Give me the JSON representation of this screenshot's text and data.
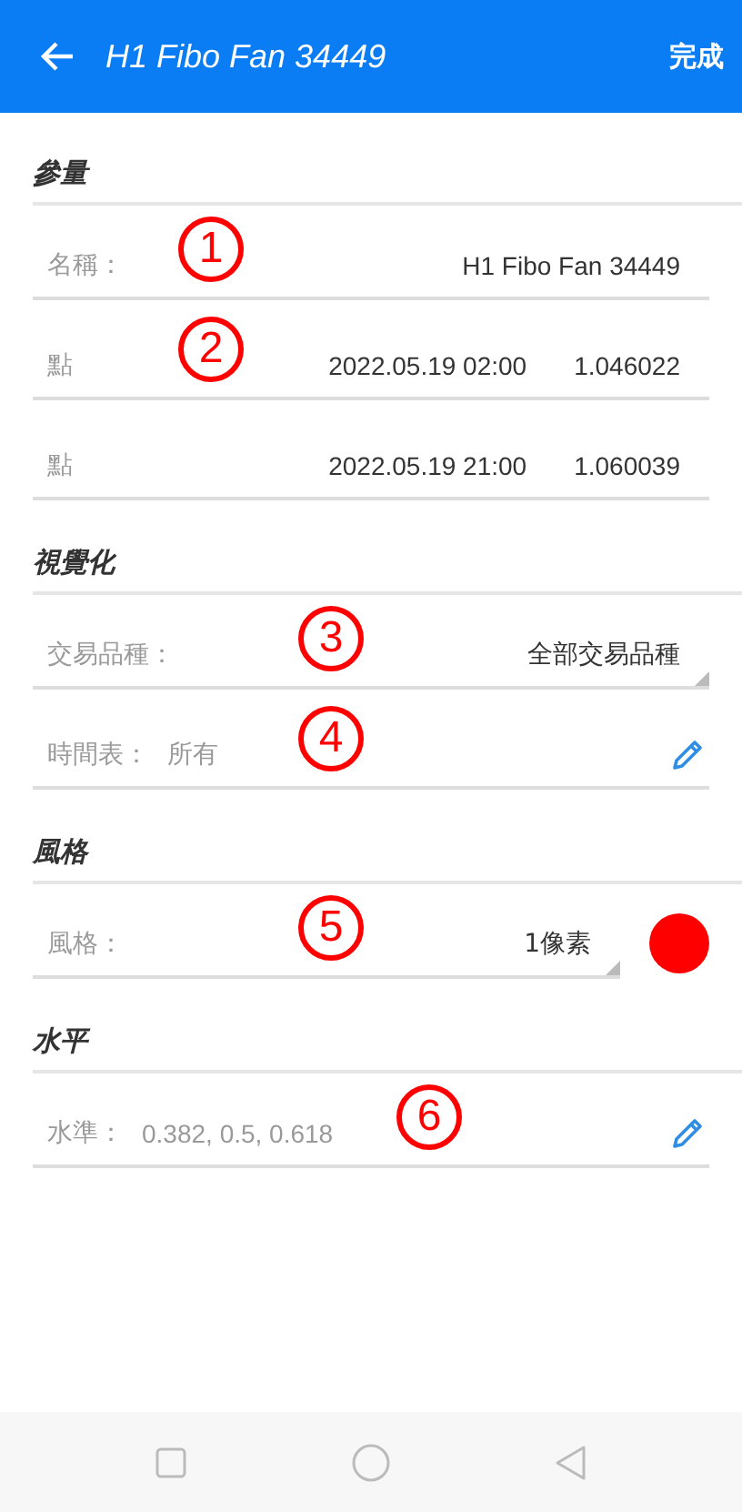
{
  "header": {
    "title": "H1 Fibo Fan 34449",
    "done": "完成"
  },
  "sections": [
    {
      "title": "參量",
      "rows": [
        {
          "kind": "text",
          "label": "名稱：",
          "value": "H1 Fibo Fan 34449",
          "marker": "1"
        },
        {
          "kind": "point",
          "label": "點",
          "date": "2022.05.19 02:00",
          "price": "1.046022",
          "marker": "2"
        },
        {
          "kind": "point",
          "label": "點",
          "date": "2022.05.19 21:00",
          "price": "1.060039"
        }
      ]
    },
    {
      "title": "視覺化",
      "rows": [
        {
          "kind": "select",
          "label": "交易品種：",
          "value": "全部交易品種",
          "marker": "3"
        },
        {
          "kind": "edit",
          "label": "時間表：",
          "value": "所有",
          "marker": "4"
        }
      ]
    },
    {
      "title": "風格",
      "rows": [
        {
          "kind": "style",
          "label": "風格：",
          "value": "1像素",
          "color": "#ff0000",
          "marker": "5"
        }
      ]
    },
    {
      "title": "水平",
      "rows": [
        {
          "kind": "edit",
          "label": "水準：",
          "value": "0.382, 0.5, 0.618",
          "marker": "6"
        }
      ]
    }
  ]
}
